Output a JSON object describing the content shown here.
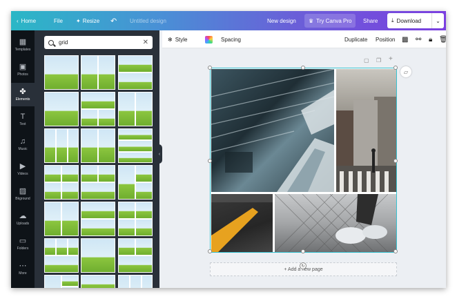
{
  "topbar": {
    "home_label": "Home",
    "file_label": "File",
    "resize_label": "Resize",
    "design_title": "Untitled design",
    "new_design_label": "New design",
    "try_pro_label": "Try Canva Pro",
    "share_label": "Share",
    "download_label": "Download"
  },
  "rail": {
    "items": [
      {
        "label": "Templates",
        "icon": "templates-icon"
      },
      {
        "label": "Photos",
        "icon": "photos-icon"
      },
      {
        "label": "Elements",
        "icon": "elements-icon"
      },
      {
        "label": "Text",
        "icon": "text-icon"
      },
      {
        "label": "Music",
        "icon": "music-icon"
      },
      {
        "label": "Videos",
        "icon": "videos-icon"
      },
      {
        "label": "Bkground",
        "icon": "background-icon"
      },
      {
        "label": "Uploads",
        "icon": "uploads-icon"
      },
      {
        "label": "Folders",
        "icon": "folders-icon"
      },
      {
        "label": "More",
        "icon": "more-icon"
      }
    ],
    "active": "Elements"
  },
  "search": {
    "value": "grid"
  },
  "context_toolbar": {
    "style_label": "Style",
    "spacing_label": "Spacing",
    "duplicate_label": "Duplicate",
    "position_label": "Position"
  },
  "canvas": {
    "add_page_label": "+ Add a new page"
  },
  "colors": {
    "accent": "#37c3d2",
    "rail_bg": "#0e1318",
    "panel_bg": "#293039"
  }
}
